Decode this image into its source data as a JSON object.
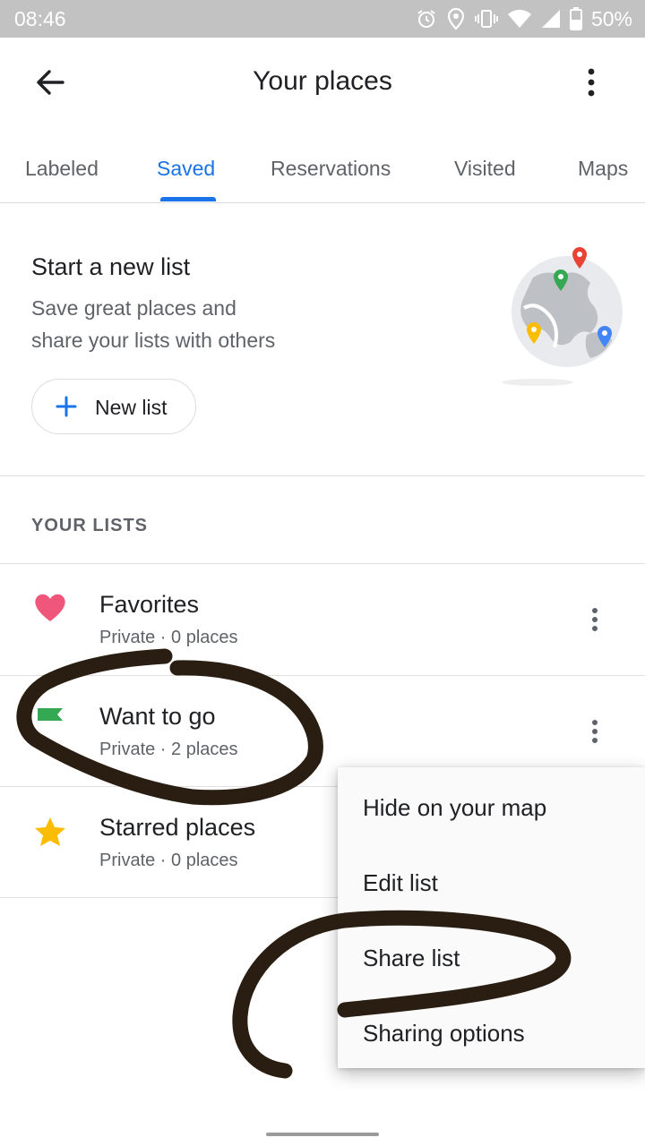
{
  "status_bar": {
    "time": "08:46",
    "battery_percent": "50%",
    "icons": [
      "alarm-icon",
      "location-icon",
      "vibrate-icon",
      "wifi-icon",
      "signal-icon",
      "battery-icon"
    ]
  },
  "app_bar": {
    "title": "Your places",
    "back_icon": "arrow-back-icon",
    "overflow_icon": "more-vert-icon"
  },
  "tabs": [
    {
      "label": "Labeled",
      "active": false
    },
    {
      "label": "Saved",
      "active": true
    },
    {
      "label": "Reservations",
      "active": false
    },
    {
      "label": "Visited",
      "active": false
    },
    {
      "label": "Maps",
      "active": false
    }
  ],
  "promo": {
    "title": "Start a new list",
    "subtitle_line1": "Save great places and",
    "subtitle_line2": "share your lists with others",
    "button_label": "New list"
  },
  "lists_section": {
    "header": "YOUR LISTS",
    "items": [
      {
        "title": "Favorites",
        "subtitle": "Private · 0 places",
        "icon": "heart-icon",
        "icon_color": "#f0557a"
      },
      {
        "title": "Want to go",
        "subtitle": "Private · 2 places",
        "icon": "flag-icon",
        "icon_color": "#34a853"
      },
      {
        "title": "Starred places",
        "subtitle": "Private · 0 places",
        "icon": "star-icon",
        "icon_color": "#fbbc04"
      }
    ]
  },
  "context_menu": {
    "items": [
      {
        "label": "Hide on your map"
      },
      {
        "label": "Edit list"
      },
      {
        "label": "Share list"
      },
      {
        "label": "Sharing options"
      }
    ]
  },
  "colors": {
    "accent": "#1a73e8",
    "status_bar": "#c2c2c2",
    "annotation_ink": "#2a1d12"
  }
}
